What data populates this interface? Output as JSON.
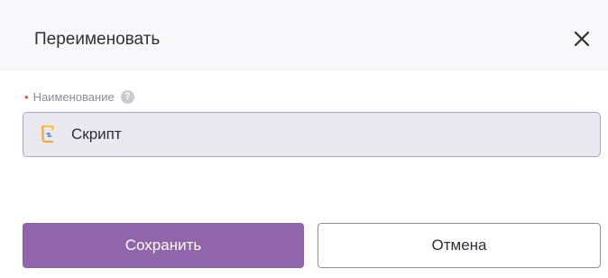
{
  "dialog": {
    "title": "Переименовать",
    "close_icon": "close-icon"
  },
  "field": {
    "required_mark": "•",
    "label": "Наименование",
    "help_icon": "question-circle-icon",
    "help_glyph": "?",
    "value": "Скрипт",
    "value_icon": "script-icon"
  },
  "actions": {
    "save_label": "Сохранить",
    "cancel_label": "Отмена"
  },
  "colors": {
    "primary": "#9065ab",
    "required": "#e5562c",
    "input_border": "#b4a0cc",
    "input_background": "#e9e8ef"
  }
}
